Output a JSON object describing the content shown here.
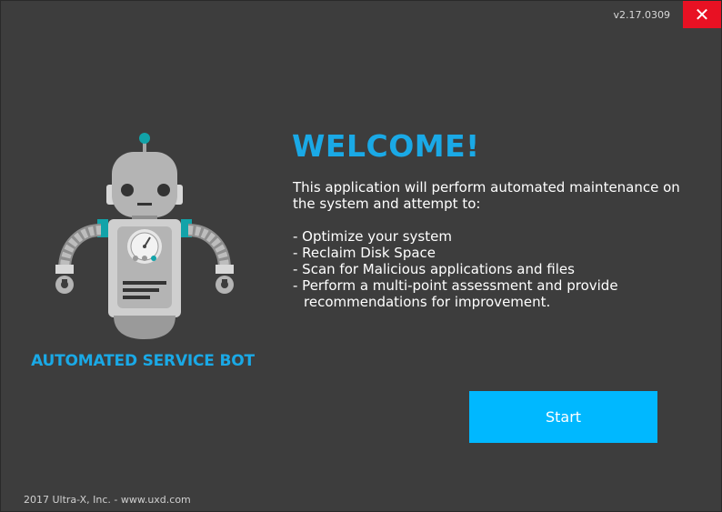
{
  "window": {
    "version": "v2.17.0309",
    "close_glyph": "✕"
  },
  "left": {
    "bot_title": "AUTOMATED SERVICE BOT",
    "bot_icon": "robot-icon"
  },
  "main": {
    "heading": "WELCOME!",
    "intro": "This application will perform automated maintenance on the system and attempt to:",
    "items": [
      "- Optimize your system",
      "- Reclaim Disk Space",
      "- Scan for Malicious applications and files",
      "- Perform a multi-point assessment and provide recommendations for improvement."
    ],
    "start_label": "Start"
  },
  "footer": {
    "text": "2017 Ultra-X, Inc. - www.uxd.com"
  },
  "colors": {
    "background": "#3d3d3d",
    "accent": "#1aa9e6",
    "button": "#00b8ff",
    "close": "#e81123"
  }
}
